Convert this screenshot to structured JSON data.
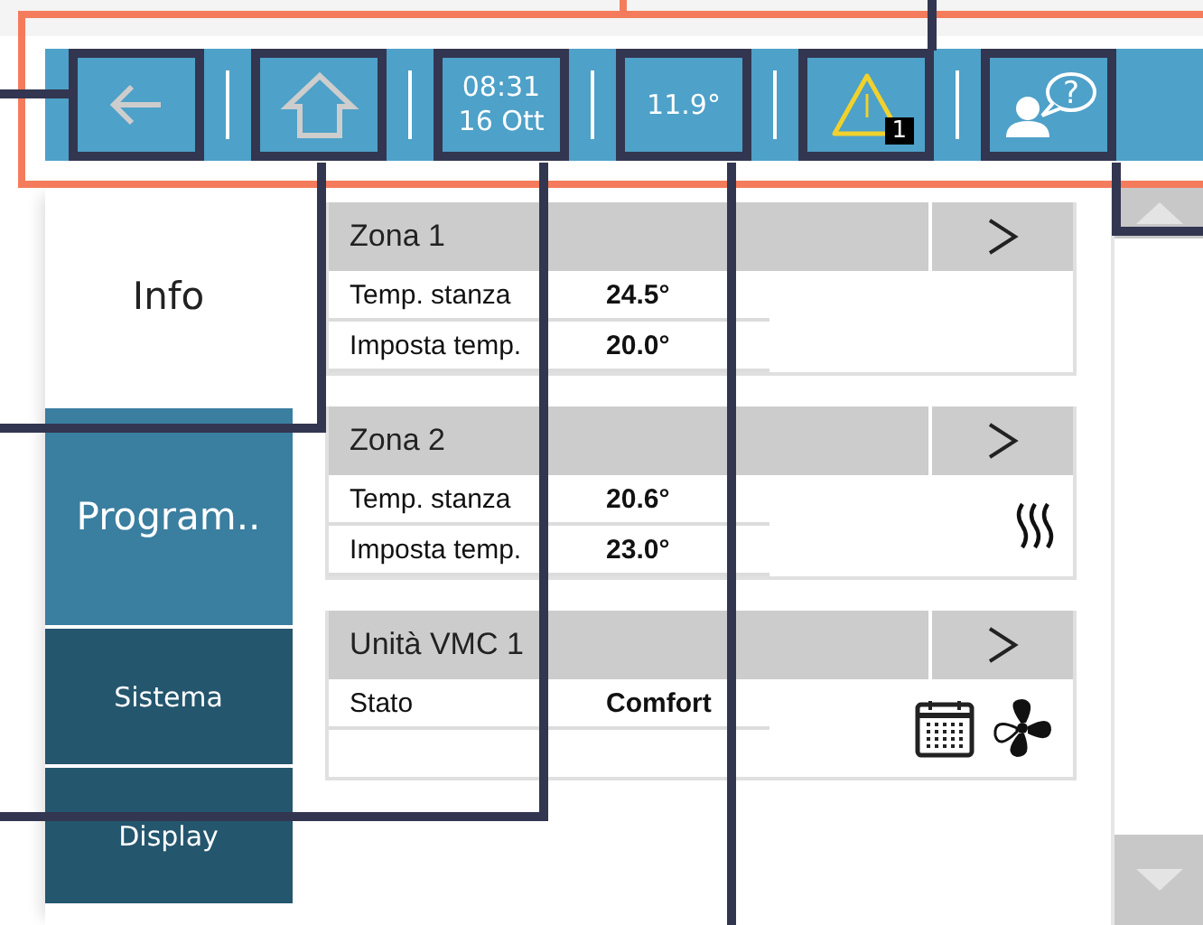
{
  "toolbar": [
    {
      "kind": "back"
    },
    {
      "kind": "home"
    },
    {
      "kind": "clock",
      "time": "08:31",
      "date": "16 Ott"
    },
    {
      "kind": "temperature",
      "value": "11.9°"
    },
    {
      "kind": "alert",
      "count": "1"
    },
    {
      "kind": "help",
      "mark": "?"
    }
  ],
  "sidebar": {
    "items": [
      {
        "label": "Info",
        "kind": "primary",
        "selected": true
      },
      {
        "label": "Program..",
        "kind": "primary",
        "selected": false
      },
      {
        "label": "Sistema",
        "kind": "secondary",
        "selected": false
      },
      {
        "label": "Display",
        "kind": "secondary",
        "selected": false
      }
    ]
  },
  "zones": [
    {
      "title": "Zona 1",
      "rows": [
        {
          "label": "Temp. stanza",
          "value": "24.5°"
        },
        {
          "label": "Imposta temp.",
          "value": "20.0°"
        }
      ],
      "heating": false,
      "scheduled": false,
      "ventilation": false
    },
    {
      "title": "Zona 2",
      "rows": [
        {
          "label": "Temp. stanza",
          "value": "20.6°"
        },
        {
          "label": "Imposta temp.",
          "value": "23.0°"
        }
      ],
      "heating": true,
      "scheduled": false,
      "ventilation": false
    },
    {
      "title": "Unità VMC 1",
      "rows": [
        {
          "label": "Stato",
          "value": "Comfort"
        }
      ],
      "heating": false,
      "scheduled": true,
      "ventilation": true
    }
  ]
}
